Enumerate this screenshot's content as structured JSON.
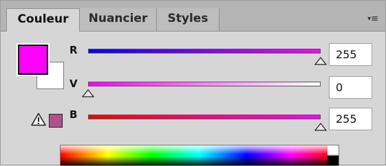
{
  "tabs": [
    {
      "label": "Couleur",
      "active": true
    },
    {
      "label": "Nuancier",
      "active": false
    },
    {
      "label": "Styles",
      "active": false
    }
  ],
  "menu_icon": "panel-menu-icon",
  "colors": {
    "foreground": "#ff00ff",
    "background": "#ffffff",
    "gamut_swatch": "#b0508c"
  },
  "channels": [
    {
      "label": "R",
      "value": "255",
      "level": 1.0
    },
    {
      "label": "V",
      "value": "0",
      "level": 0.0
    },
    {
      "label": "B",
      "value": "255",
      "level": 1.0
    }
  ],
  "warning_icon": "gamut-warning-icon"
}
